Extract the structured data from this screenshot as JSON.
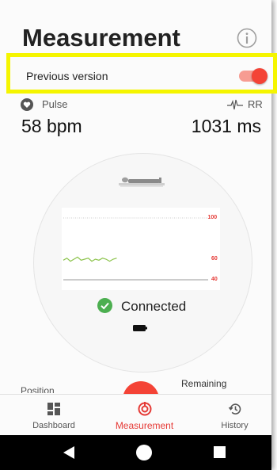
{
  "header": {
    "title": "Measurement",
    "info_icon": "info-icon"
  },
  "previous_version": {
    "label": "Previous version",
    "enabled": true,
    "accent": "#f44336"
  },
  "vitals": {
    "pulse_label": "Pulse",
    "pulse_value": "58 bpm",
    "rr_label": "RR",
    "rr_value": "1031 ms"
  },
  "chart_data": {
    "type": "line",
    "ytick_labels": [
      "100",
      "60",
      "40"
    ],
    "y_ticks": [
      100,
      60,
      40
    ],
    "ylim": [
      30,
      110
    ],
    "reference_lines": [
      100,
      40
    ],
    "series": [
      {
        "color": "#8bc34a",
        "x": [
          0,
          3,
          6,
          9,
          12,
          15,
          18,
          21,
          24,
          27,
          30,
          33,
          36,
          39,
          42,
          45
        ],
        "y": [
          59,
          61,
          58,
          60,
          62,
          59,
          60,
          61,
          58,
          60,
          59,
          61,
          60,
          58,
          60,
          61
        ]
      }
    ]
  },
  "status": {
    "connected_text": "Connected",
    "battery_icon": "battery-icon"
  },
  "footer_stats": {
    "position_label": "Position",
    "remaining_label": "Remaining"
  },
  "nav": {
    "items": [
      {
        "label": "Dashboard",
        "icon": "dashboard-icon"
      },
      {
        "label": "Measurement",
        "icon": "measurement-icon"
      },
      {
        "label": "History",
        "icon": "history-icon"
      }
    ],
    "active_color": "#e53935"
  }
}
